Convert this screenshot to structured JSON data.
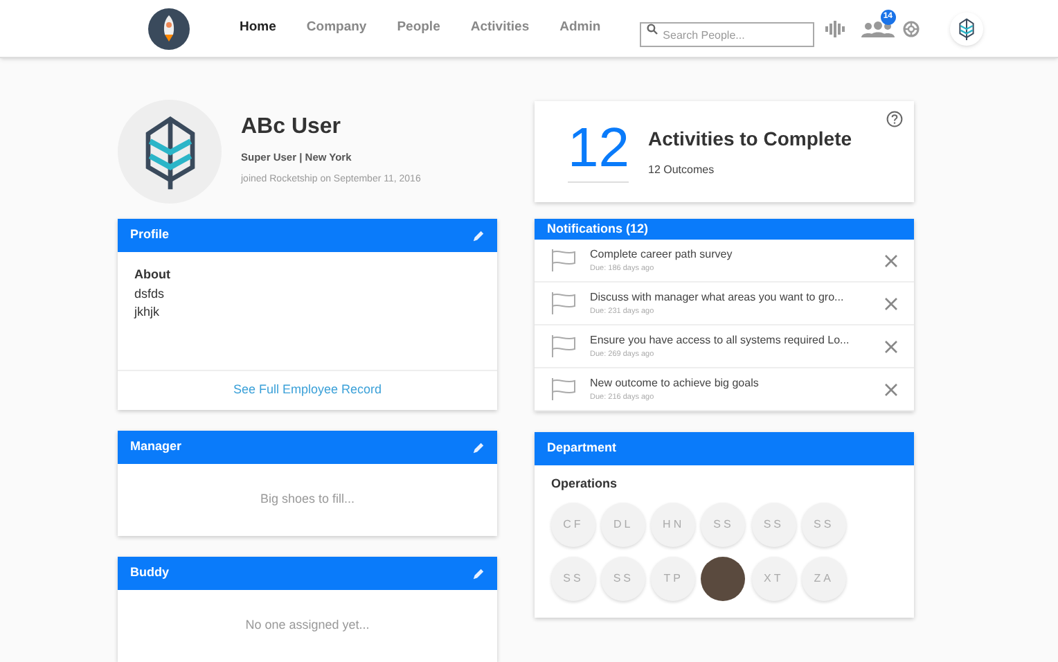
{
  "nav": {
    "links": [
      {
        "label": "Home",
        "selected": true
      },
      {
        "label": "Company",
        "selected": false
      },
      {
        "label": "People",
        "selected": false
      },
      {
        "label": "Activities",
        "selected": false
      },
      {
        "label": "Admin",
        "selected": false
      }
    ],
    "search": {
      "placeholder": "Search People..."
    },
    "people_badge": "14"
  },
  "user": {
    "name": "ABc User",
    "role": "Super User | New York",
    "joined": "joined Rocketship on September 11, 2016"
  },
  "profile": {
    "title": "Profile",
    "about_label": "About",
    "about_lines": [
      "dsfds",
      "jkhjk"
    ],
    "link": "See Full Employee Record"
  },
  "manager": {
    "title": "Manager",
    "empty": "Big shoes to fill..."
  },
  "buddy": {
    "title": "Buddy",
    "empty": "No one assigned yet..."
  },
  "activities": {
    "count": "12",
    "title": "Activities to Complete",
    "subtitle": "12 Outcomes"
  },
  "notifications": {
    "title": "Notifications (12)",
    "items": [
      {
        "text": "Complete career path survey",
        "due": "Due: 186 days ago"
      },
      {
        "text": "Discuss with manager what areas you want to gro...",
        "due": "Due: 231 days ago"
      },
      {
        "text": "Ensure you have access to all systems required Lo...",
        "due": "Due: 269 days ago"
      },
      {
        "text": "New outcome to achieve big goals",
        "due": "Due: 216 days ago"
      }
    ]
  },
  "department": {
    "title": "Department",
    "name": "Operations",
    "members": [
      {
        "kind": "initials",
        "initials": "CF"
      },
      {
        "kind": "initials",
        "initials": "DL"
      },
      {
        "kind": "initials",
        "initials": "HN"
      },
      {
        "kind": "initials",
        "initials": "SS"
      },
      {
        "kind": "initials",
        "initials": "SS"
      },
      {
        "kind": "initials",
        "initials": "SS"
      },
      {
        "kind": "initials",
        "initials": "SS"
      },
      {
        "kind": "initials",
        "initials": "SS"
      },
      {
        "kind": "initials",
        "initials": "TP"
      },
      {
        "kind": "photo"
      },
      {
        "kind": "initials",
        "initials": "XT"
      },
      {
        "kind": "initials",
        "initials": "ZA"
      }
    ]
  }
}
